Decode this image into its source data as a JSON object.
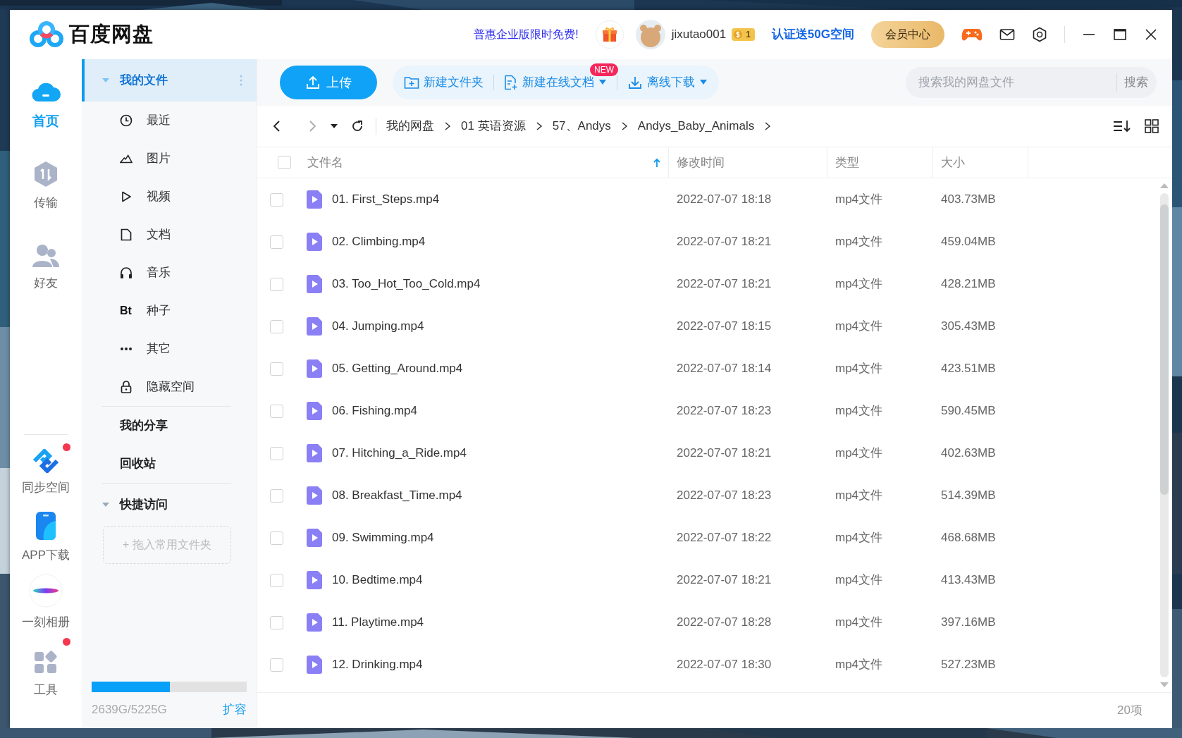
{
  "app": {
    "title": "百度网盘"
  },
  "header": {
    "promo": "普惠企业版限时免费!",
    "username": "jixutao001",
    "vip_level": "1",
    "certify": "认证送50G空间",
    "vip_button": "会员中心"
  },
  "rail": [
    {
      "label": "首页",
      "selected": true,
      "dot": false
    },
    {
      "label": "传输",
      "selected": false,
      "dot": false
    },
    {
      "label": "好友",
      "selected": false,
      "dot": false
    },
    {
      "label": "同步空间",
      "selected": false,
      "dot": true
    },
    {
      "label": "APP下载",
      "selected": false,
      "dot": false
    },
    {
      "label": "一刻相册",
      "selected": false,
      "dot": false
    },
    {
      "label": "工具",
      "selected": false,
      "dot": true
    }
  ],
  "nav": {
    "my_files": {
      "label": "我的文件",
      "selected": true,
      "expanded": true
    },
    "items": [
      {
        "label": "最近"
      },
      {
        "label": "图片"
      },
      {
        "label": "视频"
      },
      {
        "label": "文档"
      },
      {
        "label": "音乐"
      },
      {
        "label": "种子",
        "glyph": "Bt"
      },
      {
        "label": "其它"
      },
      {
        "label": "隐藏空间"
      }
    ],
    "links": [
      {
        "label": "我的分享"
      },
      {
        "label": "回收站"
      }
    ],
    "quick_access": {
      "label": "快捷访问",
      "expanded": true,
      "drop_hint": "+ 拖入常用文件夹"
    },
    "storage": {
      "level": 0.505,
      "text": "2639G/5225G",
      "expand": "扩容"
    }
  },
  "toolbar": {
    "upload": "上传",
    "new_folder": "新建文件夹",
    "new_doc": "新建在线文档",
    "new_badge": "NEW",
    "offline": "离线下载",
    "search": {
      "placeholder": "搜索我的网盘文件",
      "button": "搜索"
    }
  },
  "breadcrumb": [
    "我的网盘",
    "01 英语资源",
    "57、Andys",
    "Andys_Baby_Animals"
  ],
  "table": {
    "all_checked": false,
    "columns": [
      {
        "label": "文件名",
        "sorted": true
      },
      {
        "label": "修改时间",
        "sorted": false
      },
      {
        "label": "类型",
        "sorted": false
      },
      {
        "label": "大小",
        "sorted": false
      }
    ],
    "rows": [
      {
        "name": "01. First_Steps.mp4",
        "modified": "2022-07-07 18:18",
        "type": "mp4文件",
        "size": "403.73MB",
        "checked": false
      },
      {
        "name": "02. Climbing.mp4",
        "modified": "2022-07-07 18:21",
        "type": "mp4文件",
        "size": "459.04MB",
        "checked": false
      },
      {
        "name": "03. Too_Hot_Too_Cold.mp4",
        "modified": "2022-07-07 18:21",
        "type": "mp4文件",
        "size": "428.21MB",
        "checked": false
      },
      {
        "name": "04. Jumping.mp4",
        "modified": "2022-07-07 18:15",
        "type": "mp4文件",
        "size": "305.43MB",
        "checked": false
      },
      {
        "name": "05. Getting_Around.mp4",
        "modified": "2022-07-07 18:14",
        "type": "mp4文件",
        "size": "423.51MB",
        "checked": false
      },
      {
        "name": "06. Fishing.mp4",
        "modified": "2022-07-07 18:23",
        "type": "mp4文件",
        "size": "590.45MB",
        "checked": false
      },
      {
        "name": "07. Hitching_a_Ride.mp4",
        "modified": "2022-07-07 18:21",
        "type": "mp4文件",
        "size": "402.63MB",
        "checked": false
      },
      {
        "name": "08. Breakfast_Time.mp4",
        "modified": "2022-07-07 18:23",
        "type": "mp4文件",
        "size": "514.39MB",
        "checked": false
      },
      {
        "name": "09. Swimming.mp4",
        "modified": "2022-07-07 18:22",
        "type": "mp4文件",
        "size": "468.68MB",
        "checked": false
      },
      {
        "name": "10. Bedtime.mp4",
        "modified": "2022-07-07 18:21",
        "type": "mp4文件",
        "size": "413.43MB",
        "checked": false
      },
      {
        "name": "11. Playtime.mp4",
        "modified": "2022-07-07 18:28",
        "type": "mp4文件",
        "size": "397.16MB",
        "checked": false
      },
      {
        "name": "12. Drinking.mp4",
        "modified": "2022-07-07 18:30",
        "type": "mp4文件",
        "size": "527.23MB",
        "checked": false
      }
    ]
  },
  "footer": {
    "count": "20项"
  }
}
